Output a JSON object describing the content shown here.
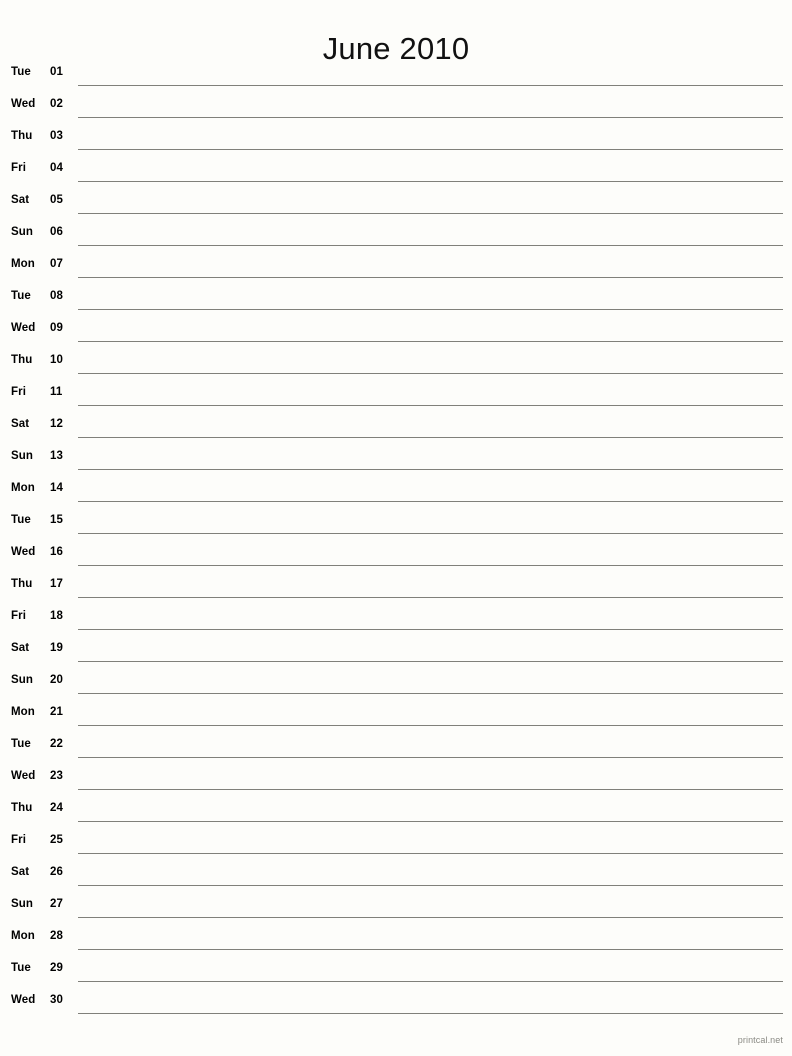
{
  "document": {
    "type": "printable-monthly-calendar",
    "title": "June 2010",
    "month": "June",
    "year": "2010"
  },
  "colors": {
    "page_background": "#fdfdfa",
    "text": "#000000",
    "rule_line": "#80807a",
    "footer_text": "#8a8a84"
  },
  "days": [
    {
      "weekday": "Tue",
      "number": "01"
    },
    {
      "weekday": "Wed",
      "number": "02"
    },
    {
      "weekday": "Thu",
      "number": "03"
    },
    {
      "weekday": "Fri",
      "number": "04"
    },
    {
      "weekday": "Sat",
      "number": "05"
    },
    {
      "weekday": "Sun",
      "number": "06"
    },
    {
      "weekday": "Mon",
      "number": "07"
    },
    {
      "weekday": "Tue",
      "number": "08"
    },
    {
      "weekday": "Wed",
      "number": "09"
    },
    {
      "weekday": "Thu",
      "number": "10"
    },
    {
      "weekday": "Fri",
      "number": "11"
    },
    {
      "weekday": "Sat",
      "number": "12"
    },
    {
      "weekday": "Sun",
      "number": "13"
    },
    {
      "weekday": "Mon",
      "number": "14"
    },
    {
      "weekday": "Tue",
      "number": "15"
    },
    {
      "weekday": "Wed",
      "number": "16"
    },
    {
      "weekday": "Thu",
      "number": "17"
    },
    {
      "weekday": "Fri",
      "number": "18"
    },
    {
      "weekday": "Sat",
      "number": "19"
    },
    {
      "weekday": "Sun",
      "number": "20"
    },
    {
      "weekday": "Mon",
      "number": "21"
    },
    {
      "weekday": "Tue",
      "number": "22"
    },
    {
      "weekday": "Wed",
      "number": "23"
    },
    {
      "weekday": "Thu",
      "number": "24"
    },
    {
      "weekday": "Fri",
      "number": "25"
    },
    {
      "weekday": "Sat",
      "number": "26"
    },
    {
      "weekday": "Sun",
      "number": "27"
    },
    {
      "weekday": "Mon",
      "number": "28"
    },
    {
      "weekday": "Tue",
      "number": "29"
    },
    {
      "weekday": "Wed",
      "number": "30"
    }
  ],
  "footer": {
    "credit": "printcal.net"
  }
}
